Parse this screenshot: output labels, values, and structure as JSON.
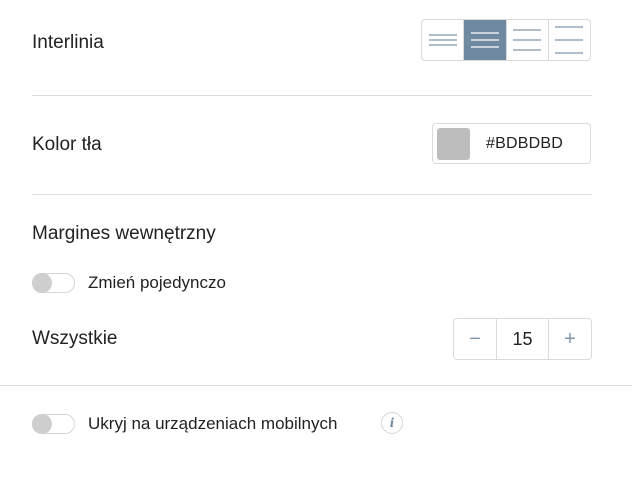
{
  "line_spacing": {
    "label": "Interlinia",
    "options": [
      "line-spacing-tight-icon",
      "line-spacing-normal-icon",
      "line-spacing-wide-icon",
      "line-spacing-widest-icon"
    ],
    "selected_index": 1
  },
  "background_color": {
    "label": "Kolor tła",
    "value": "#BDBDBD",
    "swatch_color": "#BDBDBD"
  },
  "padding": {
    "label": "Margines wewnętrzny",
    "individual_toggle_label": "Zmień pojedynczo",
    "individual_toggle_on": false,
    "all_label": "Wszystkie",
    "value": "15",
    "decrement_symbol": "−",
    "increment_symbol": "+"
  },
  "mobile": {
    "hide_label": "Ukryj na urządzeniach mobilnych",
    "hide_on": false,
    "info_symbol": "i"
  },
  "colors": {
    "accent": "#6F8AA0",
    "divider": "#DCDCDC"
  }
}
